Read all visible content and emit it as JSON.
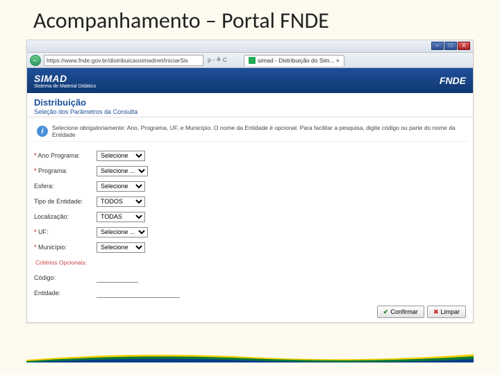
{
  "slide": {
    "title": "Acompanhamento – Portal FNDE"
  },
  "window": {
    "min": "–",
    "max": "□",
    "close": "X"
  },
  "address": {
    "url": "https://www.fnde.gov.br/distribuicaosimadnet/iniciarSis",
    "search_suffix": "ρ - ≜ C",
    "tab_label": "simad - Distribuição do Sim... ×"
  },
  "header": {
    "system": "SIMAD",
    "system_sub": "Sistema de Material Didático",
    "brand": "FNDE"
  },
  "section": {
    "title": "Distribuição",
    "subtitle": "Seleção dos Parâmetros da Consulta"
  },
  "info": {
    "text": "Selecione obrigatoriamente: Ano, Programa, UF, e Município. O nome da Entidade é opcional. Para facilitar a pesquisa, digite código ou parte do nome da Entidade"
  },
  "form": {
    "ano": {
      "label": "Ano Programa:",
      "value": "Selecione"
    },
    "programa": {
      "label": "Programa:",
      "value": "Selecione ..."
    },
    "esfera": {
      "label": "Esfera:",
      "value": "Selecione"
    },
    "tipo": {
      "label": "Tipo de Entidade:",
      "value": "TODOS"
    },
    "local": {
      "label": "Localização:",
      "value": "TODAS"
    },
    "uf": {
      "label": "UF:",
      "value": "Selecione ..."
    },
    "municipio": {
      "label": "Município:",
      "value": "Selecione"
    },
    "criterio": {
      "label": "Critérios Opcionais:"
    },
    "codigo": {
      "label": "Código:",
      "value": ""
    },
    "entidade": {
      "label": "Entidade:",
      "value": ""
    }
  },
  "buttons": {
    "confirm": "Confirmar",
    "cancel": "Limpar"
  }
}
